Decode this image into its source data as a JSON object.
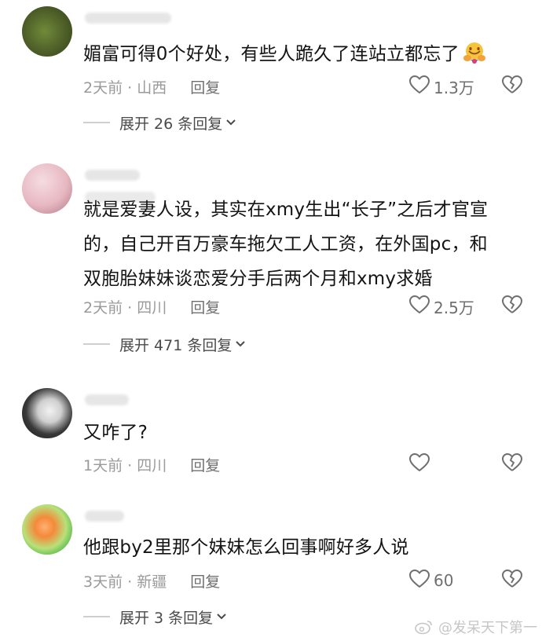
{
  "comments": [
    {
      "text": "媚富可得0个好处，有些人跪久了连站立都忘了",
      "emoji": "hugging-face-emoji",
      "time_loc": "2天前 · 山西",
      "reply_label": "回复",
      "likes": "1.3万",
      "expand_label": "展开 26 条回复",
      "avatar_color": "#5a6a32"
    },
    {
      "text_lines": [
        "就是爱妻人设，其实在xmy生出“长子”之后才官宣",
        "的，自己开百万豪车拖欠工人工资，在外国pc，和",
        "双胞胎妹妹谈恋爱分手后两个月和xmy求婚"
      ],
      "time_loc": "2天前 · 四川",
      "reply_label": "回复",
      "likes": "2.5万",
      "expand_label": "展开 471 条回复",
      "avatar_color": "#e8c0c8"
    },
    {
      "text": "又咋了?",
      "time_loc": "1天前 · 四川",
      "reply_label": "回复",
      "likes": "",
      "avatar_color": "#3a3a3a"
    },
    {
      "text": "他跟by2里那个妹妹怎么回事啊好多人说",
      "time_loc": "3天前 · 新疆",
      "reply_label": "回复",
      "likes": "60",
      "expand_label": "展开 3 条回复",
      "avatar_color": "#8fcf5a"
    }
  ],
  "watermark": "@发呆天下第一",
  "colors": {
    "text": "#141414",
    "meta": "#9a9a9a",
    "icon": "#6f6f6f"
  }
}
